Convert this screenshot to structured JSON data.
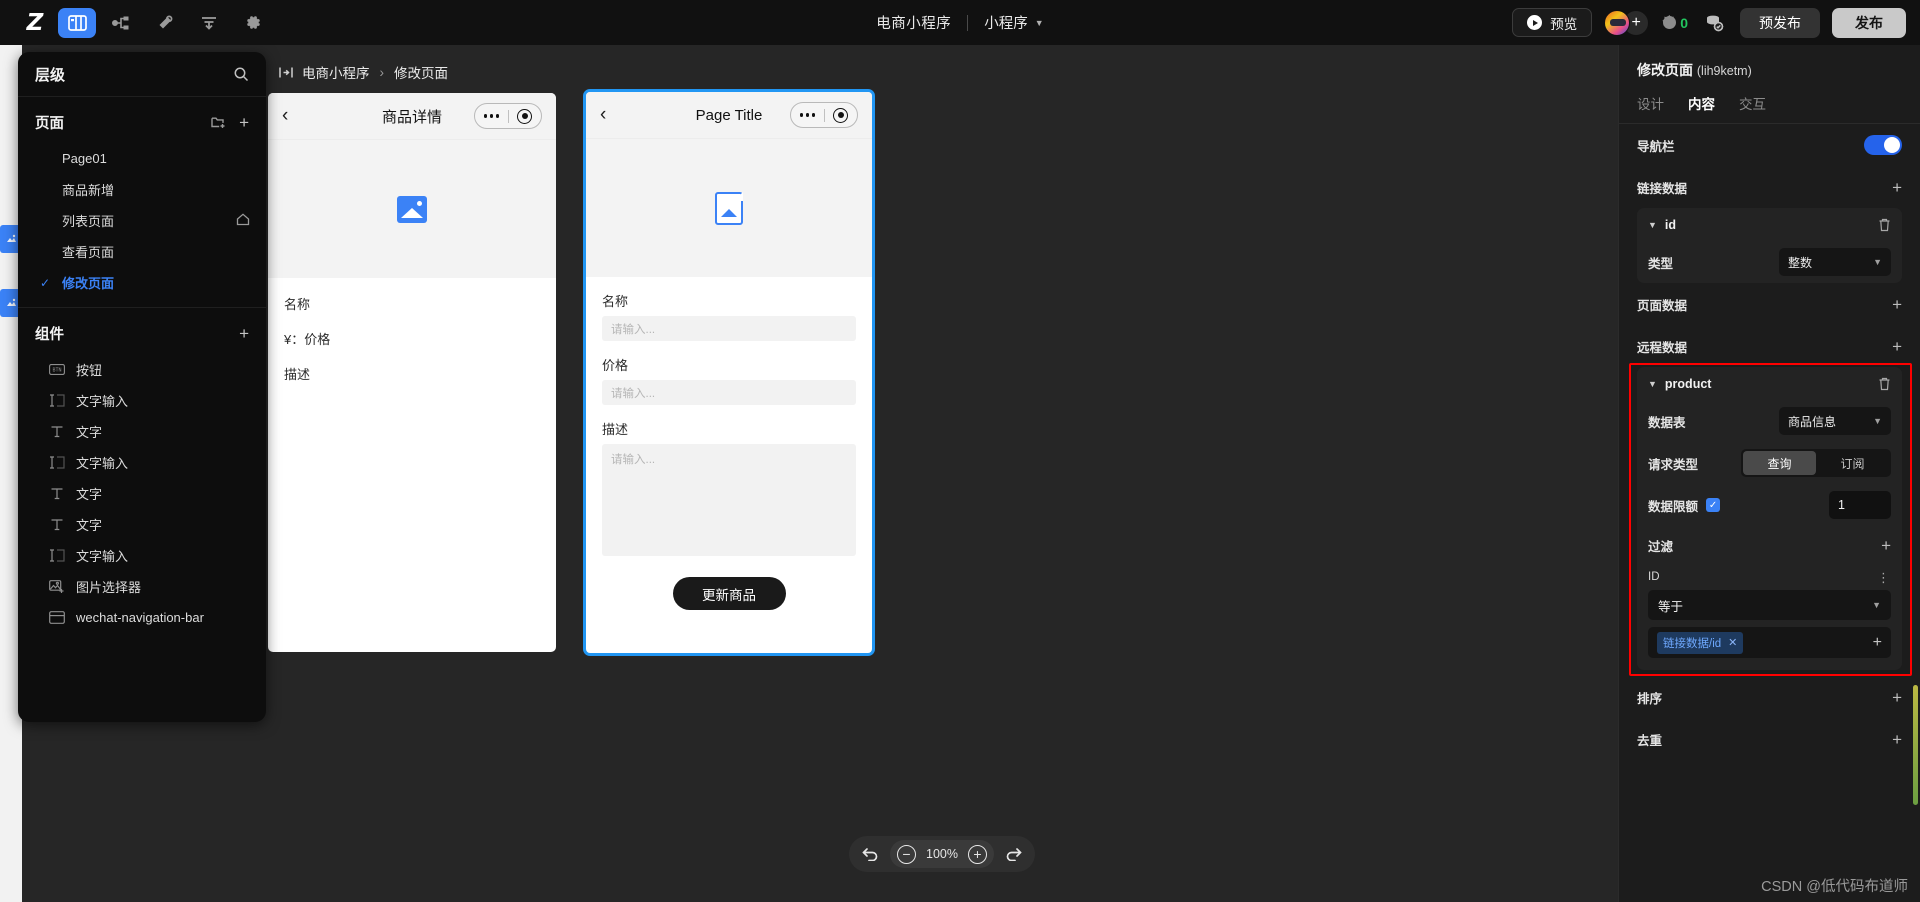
{
  "topbar": {
    "logo": "Z",
    "icons": [
      {
        "name": "panels-icon",
        "active": true
      },
      {
        "name": "sitemap-icon",
        "active": false
      },
      {
        "name": "plugin-icon",
        "active": false
      },
      {
        "name": "layers-align-icon",
        "active": false
      },
      {
        "name": "gear-icon",
        "active": false
      }
    ],
    "project_name": "电商小程序",
    "platform_name": "小程序",
    "preview_label": "预览",
    "coin_count": "0",
    "prerelease_label": "预发布",
    "publish_label": "发布"
  },
  "left_panel": {
    "title": "层级",
    "search_icon": "search-icon",
    "pages_section": {
      "title": "页面",
      "items": [
        {
          "label": "Page01",
          "selected": false,
          "home": false
        },
        {
          "label": "商品新增",
          "selected": false,
          "home": false
        },
        {
          "label": "列表页面",
          "selected": false,
          "home": true
        },
        {
          "label": "查看页面",
          "selected": false,
          "home": false
        },
        {
          "label": "修改页面",
          "selected": true,
          "home": false
        }
      ]
    },
    "components_section": {
      "title": "组件",
      "items": [
        {
          "label": "按钮",
          "icon": "button-icon"
        },
        {
          "label": "文字输入",
          "icon": "text-input-icon"
        },
        {
          "label": "文字",
          "icon": "text-icon"
        },
        {
          "label": "文字输入",
          "icon": "text-input-icon"
        },
        {
          "label": "文字",
          "icon": "text-icon"
        },
        {
          "label": "文字",
          "icon": "text-icon"
        },
        {
          "label": "文字输入",
          "icon": "text-input-icon"
        },
        {
          "label": "图片选择器",
          "icon": "image-picker-icon"
        },
        {
          "label": "wechat-navigation-bar",
          "icon": "nav-bar-icon"
        }
      ]
    }
  },
  "canvas": {
    "breadcrumb": {
      "icon": "frame-icon",
      "root": "电商小程序",
      "separator": "›",
      "current": "修改页面"
    },
    "phone_detail": {
      "nav_title": "商品详情",
      "back_icon": "chevron-left-icon",
      "fields": [
        {
          "label": "名称"
        },
        {
          "label": "¥：价格"
        },
        {
          "label": "描述"
        }
      ]
    },
    "phone_edit": {
      "nav_title": "Page Title",
      "back_icon": "chevron-left-icon",
      "name_label": "名称",
      "name_placeholder": "请输入...",
      "price_label": "价格",
      "price_placeholder": "请输入...",
      "desc_label": "描述",
      "desc_placeholder": "请输入...",
      "submit_label": "更新商品"
    },
    "zoom_toolbar": {
      "undo_icon": "undo-icon",
      "zoom_out_icon": "minus-icon",
      "zoom_level": "100%",
      "zoom_in_icon": "plus-icon",
      "redo_icon": "redo-icon"
    }
  },
  "right_panel": {
    "page_title": "修改页面",
    "page_id": "(lih9ketm)",
    "tabs": [
      {
        "label": "设计",
        "active": false
      },
      {
        "label": "内容",
        "active": true
      },
      {
        "label": "交互",
        "active": false
      }
    ],
    "nav_bar": {
      "label": "导航栏",
      "enabled": true
    },
    "link_data": {
      "title": "链接数据",
      "add_icon": "plus-icon",
      "entry": {
        "name": "id",
        "type_label": "类型",
        "type_value": "整数"
      }
    },
    "page_data": {
      "title": "页面数据",
      "add_icon": "plus-icon"
    },
    "remote_data": {
      "title": "远程数据",
      "add_icon": "plus-icon",
      "entry": {
        "name": "product",
        "table_label": "数据表",
        "table_value": "商品信息",
        "request_label": "请求类型",
        "request_options": [
          {
            "label": "查询",
            "selected": true
          },
          {
            "label": "订阅",
            "selected": false
          }
        ],
        "limit_label": "数据限额",
        "limit_checked": true,
        "limit_value": "1",
        "filter_label": "过滤",
        "filter": {
          "field": "ID",
          "operator": "等于",
          "value_tag": "链接数据/id"
        }
      }
    },
    "sort": {
      "title": "排序",
      "add_icon": "plus-icon"
    },
    "dedupe": {
      "title": "去重",
      "add_icon": "plus-icon"
    },
    "highlight_color": "#ff0000"
  },
  "watermark": "CSDN @低代码布道师"
}
